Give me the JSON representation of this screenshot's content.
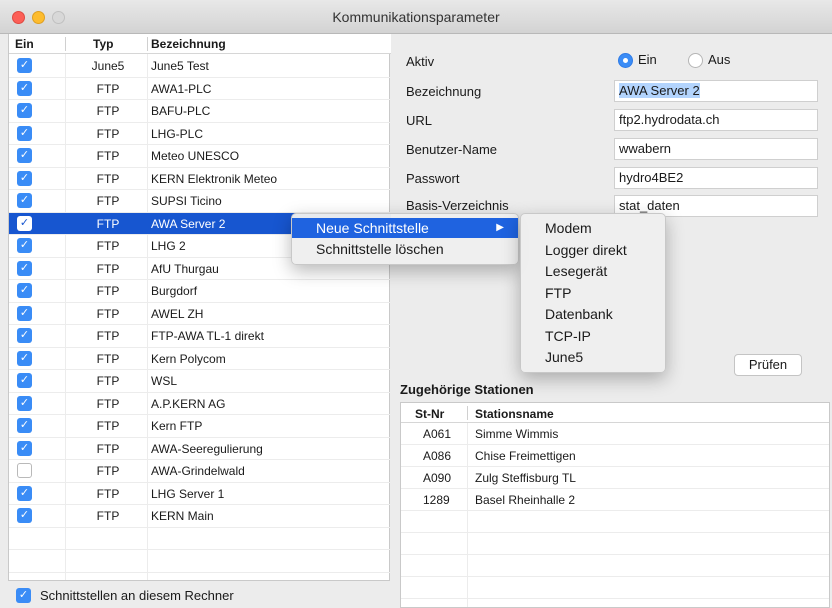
{
  "window": {
    "title": "Kommunikationsparameter"
  },
  "table": {
    "headers": {
      "ein": "Ein",
      "typ": "Typ",
      "bez": "Bezeichnung"
    },
    "rows": [
      {
        "checked": true,
        "typ": "June5",
        "bez": "June5 Test"
      },
      {
        "checked": true,
        "typ": "FTP",
        "bez": "AWA1-PLC"
      },
      {
        "checked": true,
        "typ": "FTP",
        "bez": "BAFU-PLC"
      },
      {
        "checked": true,
        "typ": "FTP",
        "bez": "LHG-PLC"
      },
      {
        "checked": true,
        "typ": "FTP",
        "bez": "Meteo UNESCO"
      },
      {
        "checked": true,
        "typ": "FTP",
        "bez": "KERN Elektronik Meteo"
      },
      {
        "checked": true,
        "typ": "FTP",
        "bez": "SUPSI Ticino"
      },
      {
        "checked": true,
        "typ": "FTP",
        "bez": "AWA Server 2",
        "selected": true
      },
      {
        "checked": true,
        "typ": "FTP",
        "bez": "LHG 2"
      },
      {
        "checked": true,
        "typ": "FTP",
        "bez": "AfU Thurgau"
      },
      {
        "checked": true,
        "typ": "FTP",
        "bez": "Burgdorf"
      },
      {
        "checked": true,
        "typ": "FTP",
        "bez": "AWEL ZH"
      },
      {
        "checked": true,
        "typ": "FTP",
        "bez": "FTP-AWA TL-1 direkt"
      },
      {
        "checked": true,
        "typ": "FTP",
        "bez": "Kern Polycom"
      },
      {
        "checked": true,
        "typ": "FTP",
        "bez": "WSL"
      },
      {
        "checked": true,
        "typ": "FTP",
        "bez": "A.P.KERN AG"
      },
      {
        "checked": true,
        "typ": "FTP",
        "bez": "Kern FTP"
      },
      {
        "checked": true,
        "typ": "FTP",
        "bez": "AWA-Seeregulierung"
      },
      {
        "checked": false,
        "typ": "FTP",
        "bez": "AWA-Grindelwald"
      },
      {
        "checked": true,
        "typ": "FTP",
        "bez": "LHG Server 1"
      },
      {
        "checked": true,
        "typ": "FTP",
        "bez": "KERN Main"
      }
    ]
  },
  "footer": {
    "checkbox_label": "Schnittstellen an diesem Rechner",
    "checked": true
  },
  "form": {
    "aktiv_label": "Aktiv",
    "ein_label": "Ein",
    "aus_label": "Aus",
    "aktiv_value": "Ein",
    "bezeichnung_label": "Bezeichnung",
    "bezeichnung_value": "AWA Server 2",
    "url_label": "URL",
    "url_value": "ftp2.hydrodata.ch",
    "user_label": "Benutzer-Name",
    "user_value": "wwabern",
    "pass_label": "Passwort",
    "pass_value": "hydro4BE2",
    "dir_label": "Basis-Verzeichnis",
    "dir_value": "stat_daten",
    "pruefen_label": "Prüfen"
  },
  "stations": {
    "title": "Zugehörige Stationen",
    "headers": {
      "nr": "St-Nr",
      "name": "Stationsname"
    },
    "rows": [
      {
        "nr": "A061",
        "name": "Simme Wimmis"
      },
      {
        "nr": "A086",
        "name": "Chise Freimettigen"
      },
      {
        "nr": "A090",
        "name": "Zulg Steffisburg TL"
      },
      {
        "nr": "1289",
        "name": "Basel Rheinhalle 2"
      }
    ]
  },
  "context_menu": {
    "items": [
      "Neue Schnittstelle",
      "Schnittstelle löschen"
    ],
    "active": "Neue Schnittstelle",
    "submenu": [
      "Modem",
      "Logger direkt",
      "Lesegerät",
      "FTP",
      "Datenbank",
      "TCP-IP",
      "June5"
    ]
  },
  "colors": {
    "selection": "#1756d0",
    "checkbox": "#3a8cf6",
    "menu_active": "#1f63e0"
  }
}
